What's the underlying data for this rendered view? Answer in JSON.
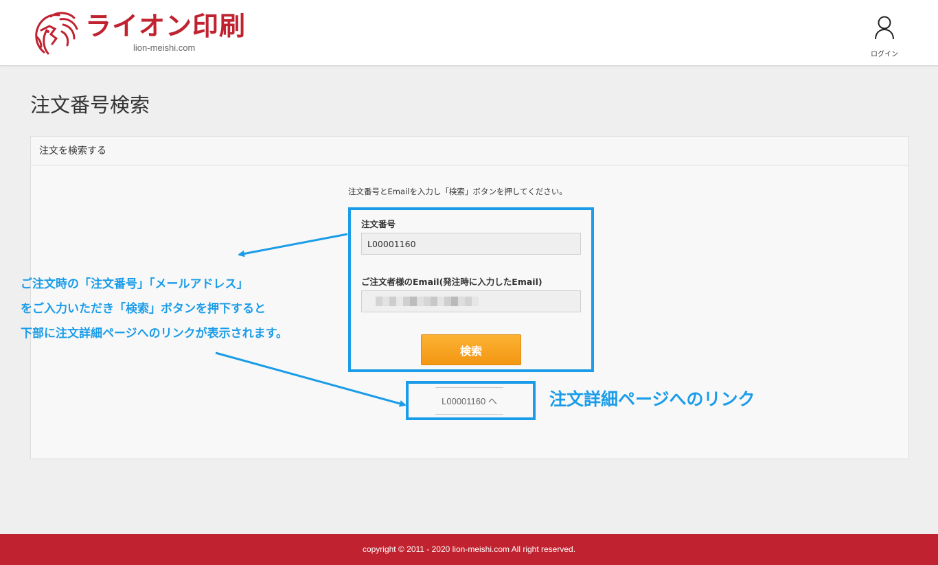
{
  "brand": {
    "title": "ライオン印刷",
    "subtitle": "lion-meishi.com",
    "color": "#c0222f"
  },
  "header": {
    "login_label": "ログイン",
    "login_icon": "user-icon"
  },
  "page": {
    "title": "注文番号検索"
  },
  "panel": {
    "heading": "注文を検索する",
    "instruction": "注文番号とEmailを入力し「検索」ボタンを押してください。"
  },
  "form": {
    "order_number_label": "注文番号",
    "order_number_value": "L00001160",
    "email_label": "ご注文者様のEmail(発注時に入力したEmail)",
    "email_value_masked": true,
    "search_button_label": "検索"
  },
  "result": {
    "order_link_label": "L00001160 へ"
  },
  "annotations": {
    "lines": [
      "ご注文時の「注文番号」「メールアドレス」",
      "をご入力いただき「検索」ボタンを押下すると",
      "下部に注文詳細ページへのリンクが表示されます。"
    ],
    "link_caption": "注文詳細ページへのリンク",
    "color": "#1a9ce8"
  },
  "footer": {
    "copyright": "copyright © 2011 - 2020 lion-meishi.com All right reserved.",
    "color": "#c1222f"
  }
}
